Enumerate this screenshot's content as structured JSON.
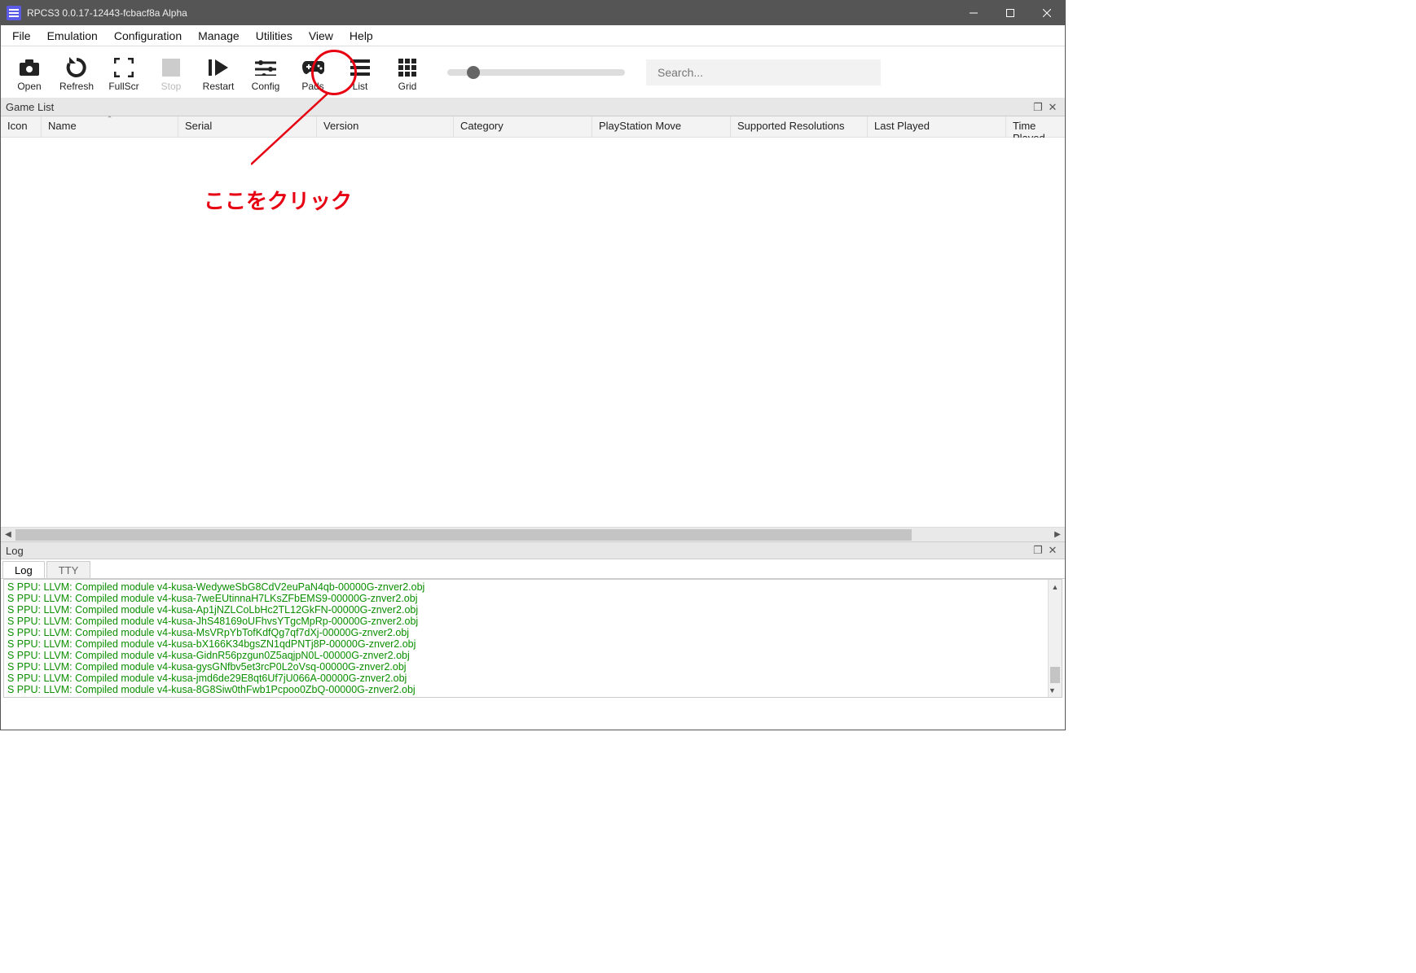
{
  "title": "RPCS3 0.0.17-12443-fcbacf8a Alpha",
  "menu": {
    "file": "File",
    "emulation": "Emulation",
    "configuration": "Configuration",
    "manage": "Manage",
    "utilities": "Utilities",
    "view": "View",
    "help": "Help"
  },
  "toolbar": {
    "open": "Open",
    "refresh": "Refresh",
    "fullscr": "FullScr",
    "stop": "Stop",
    "restart": "Restart",
    "config": "Config",
    "pads": "Pads",
    "list": "List",
    "grid": "Grid",
    "search_placeholder": "Search..."
  },
  "gamelist": {
    "header": "Game List",
    "columns": {
      "icon": "Icon",
      "name": "Name",
      "serial": "Serial",
      "version": "Version",
      "category": "Category",
      "psmove": "PlayStation Move",
      "resolutions": "Supported Resolutions",
      "lastplayed": "Last Played",
      "timeplayed": "Time Played"
    }
  },
  "log": {
    "header": "Log",
    "tab_log": "Log",
    "tab_tty": "TTY",
    "lines": [
      "S PPU: LLVM: Compiled module v4-kusa-WedyweSbG8CdV2euPaN4qb-00000G-znver2.obj",
      "S PPU: LLVM: Compiled module v4-kusa-7weEUtinnaH7LKsZFbEMS9-00000G-znver2.obj",
      "S PPU: LLVM: Compiled module v4-kusa-Ap1jNZLCoLbHc2TL12GkFN-00000G-znver2.obj",
      "S PPU: LLVM: Compiled module v4-kusa-JhS48169oUFhvsYTgcMpRp-00000G-znver2.obj",
      "S PPU: LLVM: Compiled module v4-kusa-MsVRpYbTofKdfQg7qf7dXj-00000G-znver2.obj",
      "S PPU: LLVM: Compiled module v4-kusa-bX166K34bgsZN1qdPNTj8P-00000G-znver2.obj",
      "S PPU: LLVM: Compiled module v4-kusa-GidnR56pzgun0Z5aqjpN0L-00000G-znver2.obj",
      "S PPU: LLVM: Compiled module v4-kusa-gysGNfbv5et3rcP0L2oVsq-00000G-znver2.obj",
      "S PPU: LLVM: Compiled module v4-kusa-jmd6de29E8qt6Uf7jU066A-00000G-znver2.obj",
      "S PPU: LLVM: Compiled module v4-kusa-8G8Siw0thFwb1Pcpoo0ZbQ-00000G-znver2.obj"
    ]
  },
  "annotation": {
    "text": "ここをクリック"
  }
}
